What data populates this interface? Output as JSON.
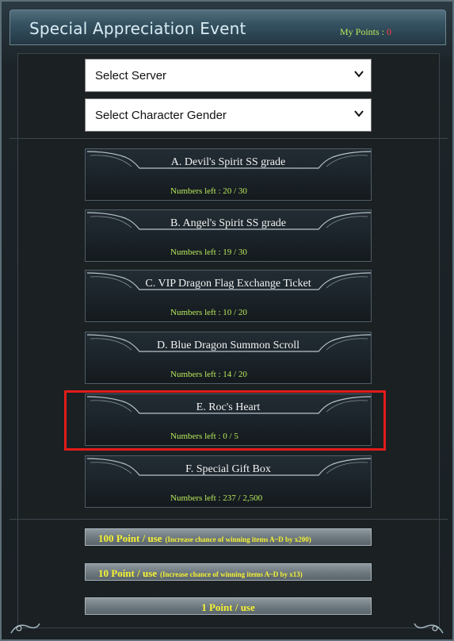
{
  "header": {
    "title": "Special Appreciation Event",
    "points_label": "My Points : ",
    "points_value": "0"
  },
  "selects": {
    "server": "Select Server",
    "gender": "Select Character Gender"
  },
  "items": [
    {
      "name": "A. Devil's Spirit SS grade",
      "left": "Numbers left : 20 / 30"
    },
    {
      "name": "B. Angel's Spirit SS grade",
      "left": "Numbers left : 19 / 30"
    },
    {
      "name": "C. VIP Dragon Flag Exchange Ticket",
      "left": "Numbers left : 10 / 20"
    },
    {
      "name": "D. Blue Dragon Summon Scroll",
      "left": "Numbers left : 14 / 20"
    },
    {
      "name": "E. Roc's Heart",
      "left": "Numbers left : 0 / 5"
    },
    {
      "name": "F. Special Gift Box",
      "left": "Numbers left : 237 / 2,500"
    }
  ],
  "use_buttons": [
    {
      "label": "100 Point / use",
      "note": "(Increase chance of winning items A~D by x200)"
    },
    {
      "label": "10 Point / use",
      "note": "(Increase chance of winning items A~D by x13)"
    },
    {
      "label": "1 Point / use",
      "note": ""
    }
  ],
  "colors": {
    "accent_green": "#b7e85b",
    "highlight_red": "#e11b1b",
    "button_text_yellow": "#f5f233"
  }
}
